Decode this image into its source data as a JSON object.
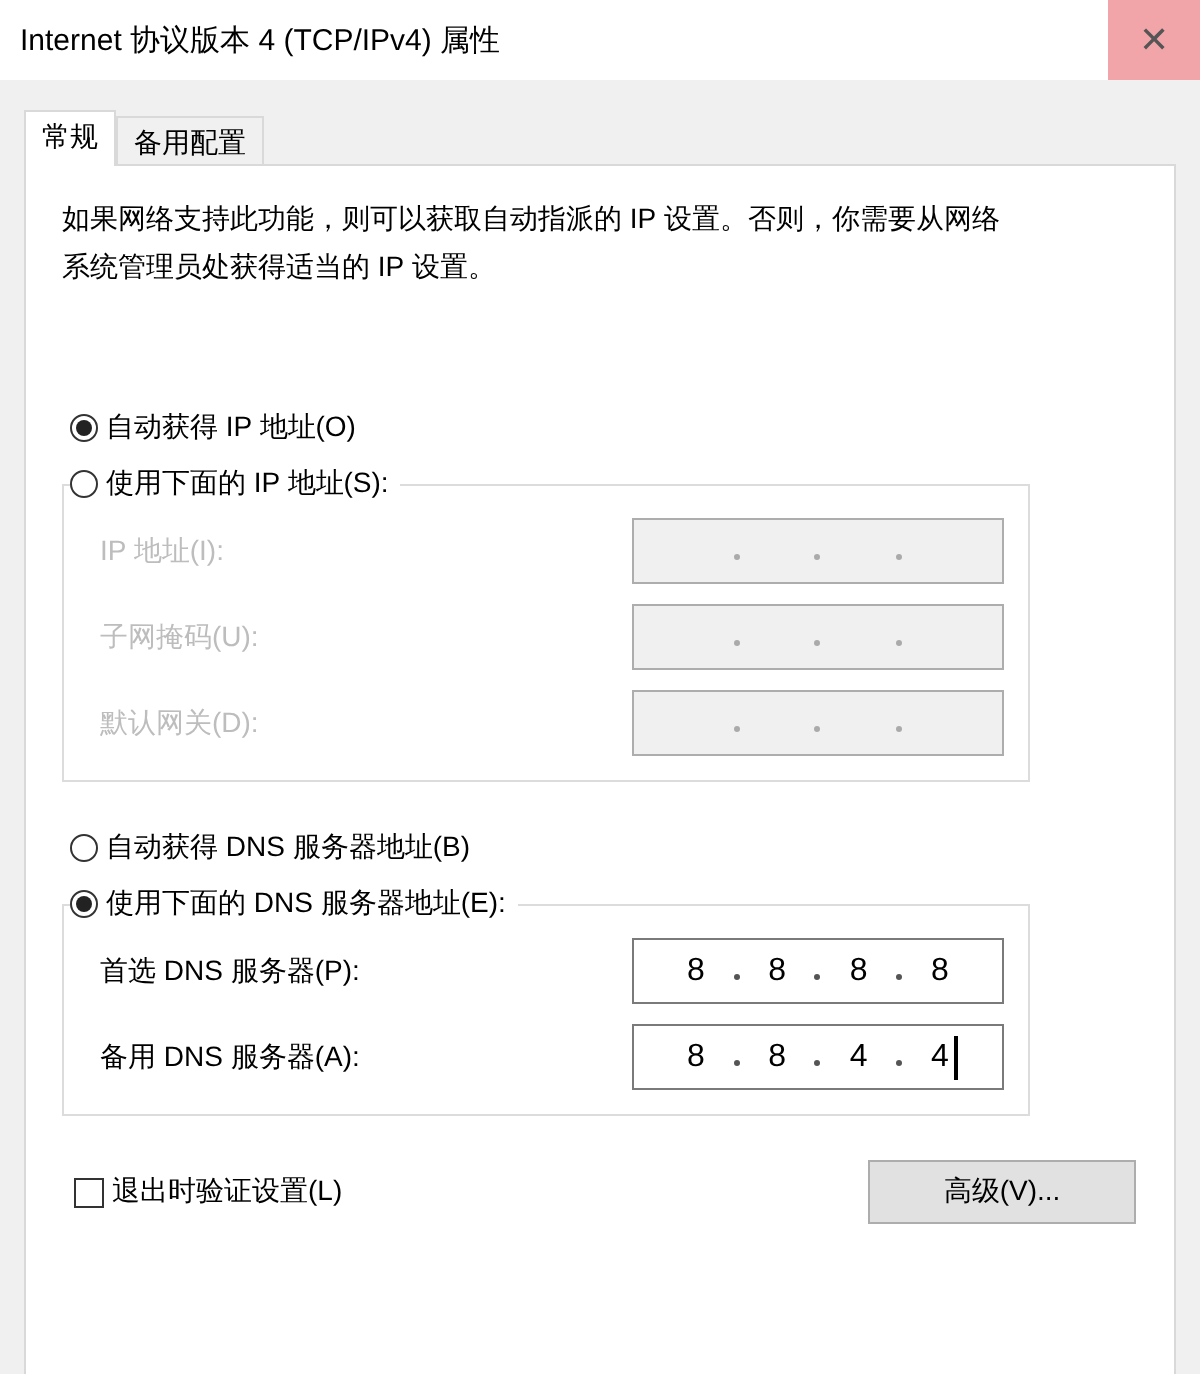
{
  "window": {
    "title": "Internet 协议版本 4 (TCP/IPv4) 属性",
    "close": "✕"
  },
  "tabs": [
    {
      "label": "常规",
      "selected": true
    },
    {
      "label": "备用配置",
      "selected": false
    }
  ],
  "description": "如果网络支持此功能，则可以获取自动指派的 IP 设置。否则，你需要从网络系统管理员处获得适当的 IP 设置。",
  "ip_options": [
    {
      "label": "自动获得 IP 地址(O)",
      "selected": true
    },
    {
      "label": "使用下面的 IP 地址(S):",
      "selected": false
    }
  ],
  "ip_fields": [
    {
      "label": "IP 地址(I):",
      "disabled": true
    },
    {
      "label": "子网掩码(U):",
      "disabled": true
    },
    {
      "label": "默认网关(D):",
      "disabled": true
    }
  ],
  "dns_options": [
    {
      "label": "自动获得 DNS 服务器地址(B)",
      "selected": false
    },
    {
      "label": "使用下面的 DNS 服务器地址(E):",
      "selected": true
    }
  ],
  "dns_fields": [
    {
      "label": "首选 DNS 服务器(P):",
      "disabled": false,
      "octets": [
        "8",
        "8",
        "8",
        "8"
      ]
    },
    {
      "label": "备用 DNS 服务器(A):",
      "disabled": false,
      "focused": true,
      "octets": [
        "8",
        "8",
        "4",
        "4"
      ]
    }
  ],
  "validate": {
    "label": "退出时验证设置(L)",
    "checked": false
  },
  "advanced_button": "高级(V)..."
}
